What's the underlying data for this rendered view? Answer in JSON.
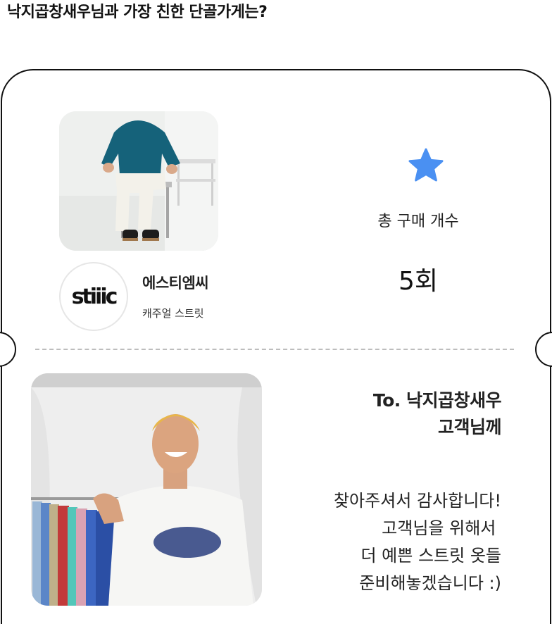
{
  "header": {
    "nickname": "낙지곱창새우",
    "question": "님과 가장 친한 단골가게는?"
  },
  "store": {
    "photo_icon": "store-model-photo",
    "logo_text": "stiiic",
    "name": "에스티엠씨",
    "category": "캐주얼 스트릿"
  },
  "stats": {
    "icon": "star-icon",
    "icon_color": "#4a90f2",
    "label": "총 구매 개수",
    "value": "5회"
  },
  "message": {
    "photo_icon": "store-owner-photo",
    "to_line1": "To. 낙지곱창새우",
    "to_line2": "고객님께",
    "lines": [
      "찾아주셔서 감사합니다!",
      "고객님을 위해서 ",
      "더 예쁜 스트릿 옷들",
      "준비해놓겠습니다 :)"
    ]
  },
  "colors": {
    "border": "#111111",
    "dashed_divider": "#bdbdbd",
    "accent_star": "#4a90f2"
  }
}
